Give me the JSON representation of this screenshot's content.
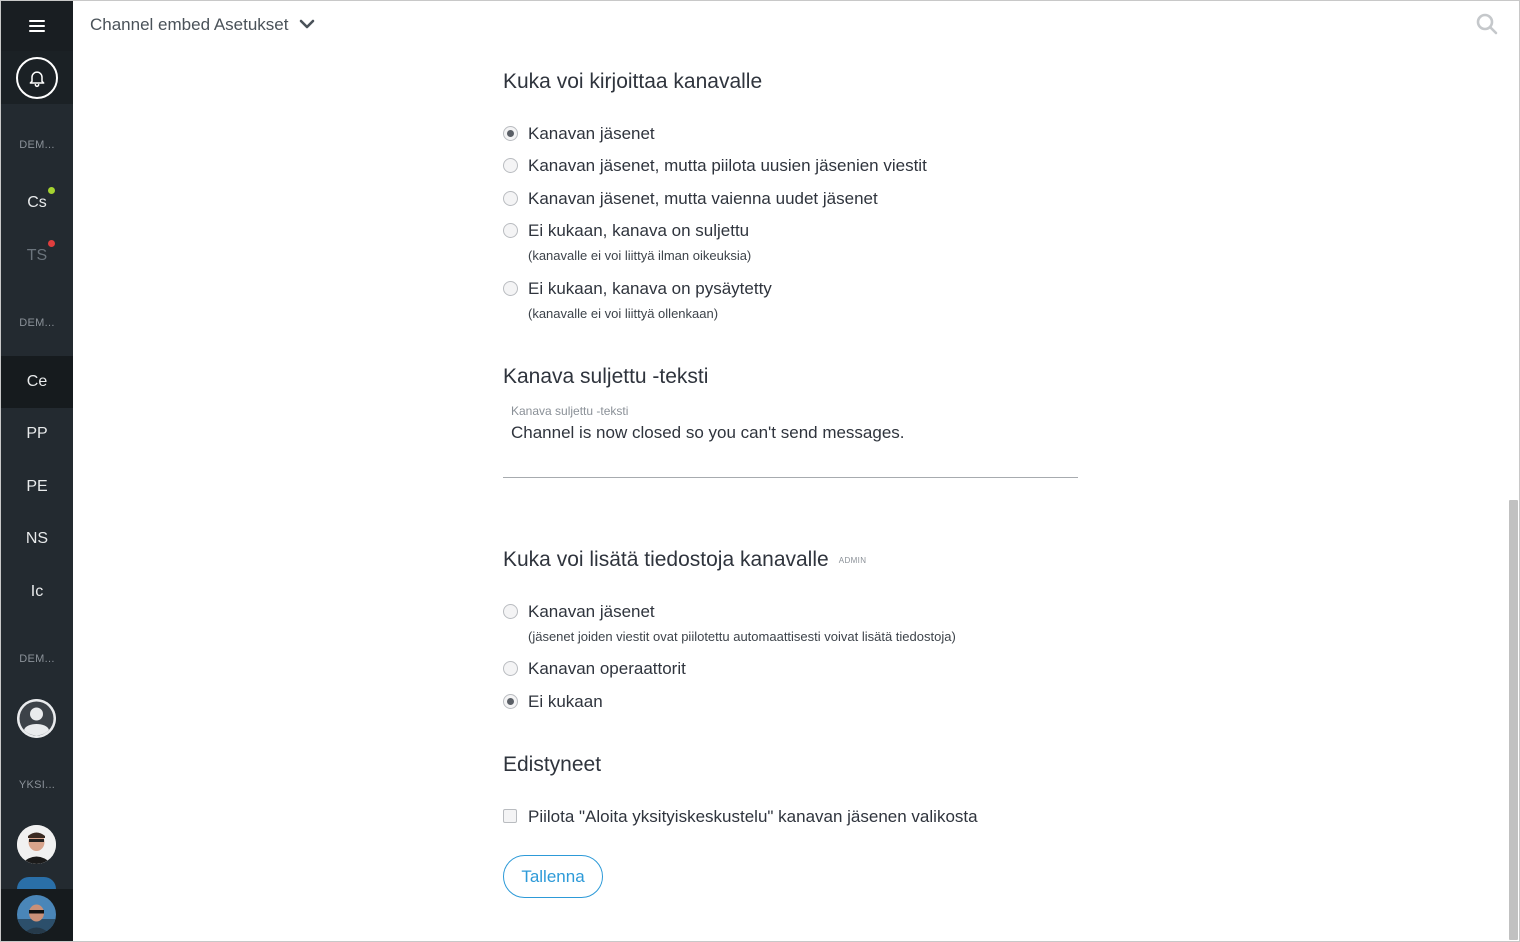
{
  "header": {
    "title": "Channel embed Asetukset"
  },
  "sidebar": {
    "sections": [
      "DEM...",
      "DEM...",
      "DEM...",
      "YKSI..."
    ],
    "items": [
      {
        "label": "Cs",
        "status": "online",
        "status_color": "#a5d330"
      },
      {
        "label": "TS",
        "status": "busy",
        "status_color": "#e03e3e"
      },
      {
        "label": "Ce"
      },
      {
        "label": "PP"
      },
      {
        "label": "PE"
      },
      {
        "label": "NS"
      },
      {
        "label": "Ic"
      }
    ]
  },
  "write_section": {
    "title": "Kuka voi kirjoittaa kanavalle",
    "options": [
      {
        "label": "Kanavan jäsenet",
        "checked": true
      },
      {
        "label": "Kanavan jäsenet, mutta piilota uusien jäsenien viestit",
        "checked": false
      },
      {
        "label": "Kanavan jäsenet, mutta vaienna uudet jäsenet",
        "checked": false
      },
      {
        "label": "Ei kukaan, kanava on suljettu",
        "sub": "(kanavalle ei voi liittyä ilman oikeuksia)",
        "checked": false
      },
      {
        "label": "Ei kukaan, kanava on pysäytetty",
        "sub": "(kanavalle ei voi liittyä ollenkaan)",
        "checked": false
      }
    ]
  },
  "closed_text_section": {
    "title": "Kanava suljettu -teksti",
    "field_label": "Kanava suljettu -teksti",
    "field_value": "Channel is now closed so you can't send messages."
  },
  "files_section": {
    "title": "Kuka voi lisätä tiedostoja kanavalle",
    "badge": "ADMIN",
    "options": [
      {
        "label": "Kanavan jäsenet",
        "sub": "(jäsenet joiden viestit ovat piilotettu automaattisesti voivat lisätä tiedostoja)",
        "checked": false
      },
      {
        "label": "Kanavan operaattorit",
        "checked": false
      },
      {
        "label": "Ei kukaan",
        "checked": true
      }
    ]
  },
  "advanced_section": {
    "title": "Edistyneet",
    "checkbox_label": "Piilota \"Aloita yksityiskeskustelu\" kanavan jäsenen valikosta",
    "checkbox_checked": false
  },
  "save_button": {
    "label": "Tallenna"
  },
  "colors": {
    "sidebar_bg": "#232a30",
    "accent": "#2d9ad8"
  }
}
